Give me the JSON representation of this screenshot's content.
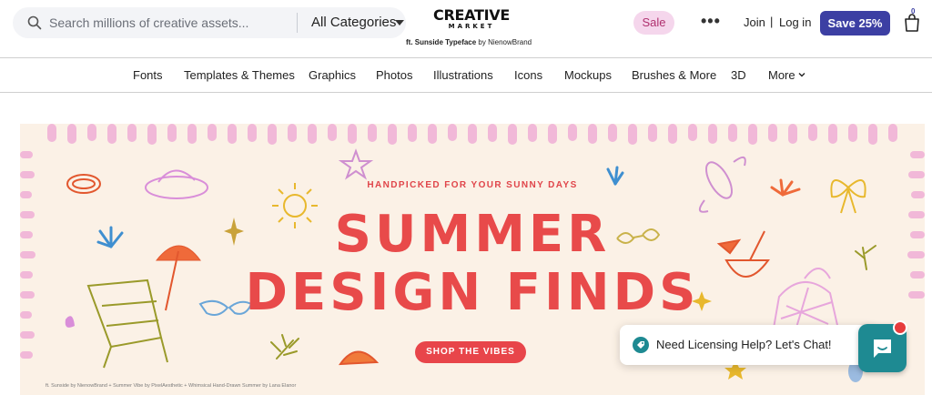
{
  "header": {
    "search_placeholder": "Search millions of creative assets...",
    "category_select": "All Categories",
    "logo_main": "CREATIVE",
    "logo_sub": "MARKET",
    "logo_credit_bold": "ft. Sunside Typeface",
    "logo_credit_rest": " by NienowBrand",
    "sale_label": "Sale",
    "more_label": "•••",
    "join_label": "Join",
    "separator": "|",
    "login_label": "Log in",
    "save_label": "Save 25%",
    "cart_count": "0"
  },
  "nav": {
    "items": [
      "Fonts",
      "Templates & Themes",
      "Graphics",
      "Photos",
      "Illustrations",
      "Icons",
      "Mockups",
      "Brushes & More",
      "3D",
      "More"
    ]
  },
  "banner": {
    "kicker": "HANDPICKED FOR YOUR SUNNY DAYS",
    "title_line1": "SUMMER",
    "title_line2": "DESIGN FINDS",
    "cta": "SHOP THE VIBES",
    "credit": "ft. Sunside by NienowBrand + Summer Vibe by PixelAesthetic + Whimsical Hand-Drawn Summer by Lana Elanor"
  },
  "chat": {
    "bubble_text": "Need Licensing Help? Let's Chat!"
  },
  "colors": {
    "accent": "#3c3fa3",
    "banner_red": "#e84a4a",
    "banner_bg": "#fbf1e6",
    "sale_bg": "#f5d6ec",
    "chat_teal": "#1e8a92"
  },
  "icons": [
    "search-icon",
    "chevron-down-icon",
    "more-dots-icon",
    "cart-icon",
    "chat-icon",
    "tag-icon"
  ]
}
